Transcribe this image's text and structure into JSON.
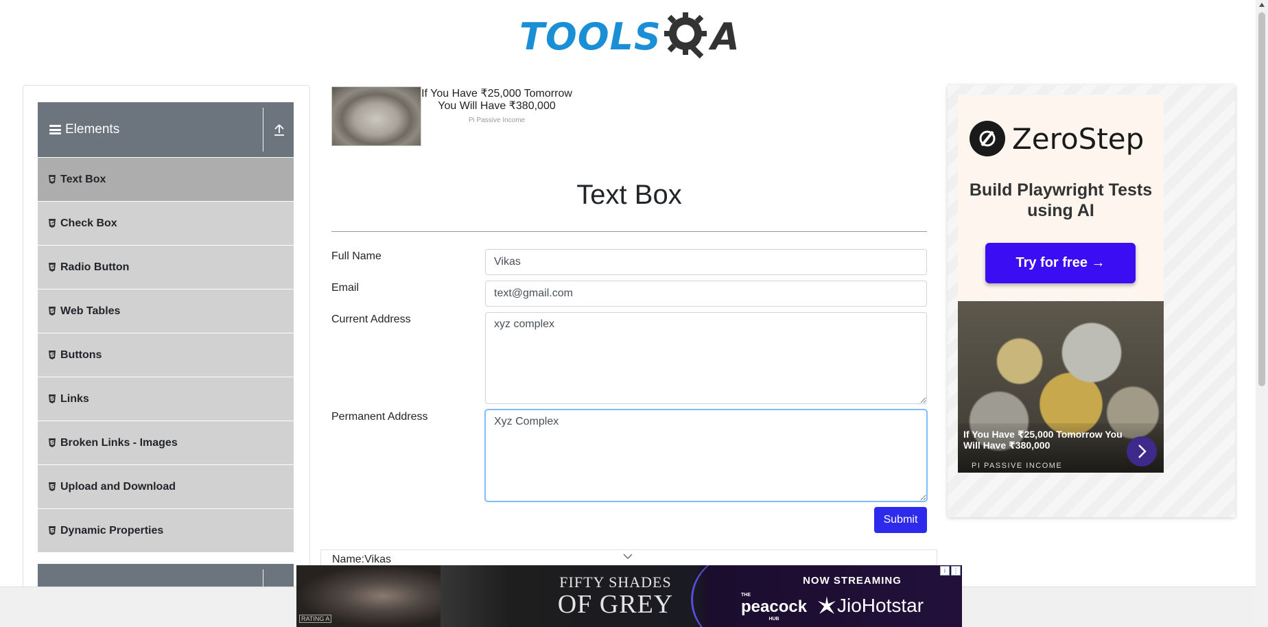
{
  "header": {
    "logo_tools": "TOOLS",
    "logo_a": "A"
  },
  "sidebar": {
    "group_title": "Elements",
    "items": [
      {
        "label": "Text Box",
        "active": true
      },
      {
        "label": "Check Box"
      },
      {
        "label": "Radio Button"
      },
      {
        "label": "Web Tables"
      },
      {
        "label": "Buttons"
      },
      {
        "label": "Links"
      },
      {
        "label": "Broken Links - Images"
      },
      {
        "label": "Upload and Download"
      },
      {
        "label": "Dynamic Properties"
      }
    ]
  },
  "ad_top": {
    "headline": "If You Have ₹25,000 Tomorrow You Will Have ₹380,000",
    "source": "Pi Passive Income"
  },
  "main": {
    "title": "Text Box",
    "form": {
      "full_name_label": "Full Name",
      "full_name_value": "Vikas",
      "email_label": "Email",
      "email_value": "text@gmail.com",
      "current_address_label": "Current Address",
      "current_address_value": "xyz complex",
      "permanent_address_label": "Permanent Address",
      "permanent_address_value": "Xyz Complex",
      "submit_label": "Submit"
    },
    "output": {
      "name_line": "Name:Vikas"
    }
  },
  "ad_right": {
    "brand": "ZeroStep",
    "tagline": "Build Playwright Tests using AI",
    "cta": "Try for free →",
    "coins_headline": "If You Have ₹25,000 Tomorrow You Will Have ₹380,000",
    "coins_source": "PI PASSIVE INCOME"
  },
  "banner_ad": {
    "title_line1": "FIFTY SHADES",
    "title_line2": "OF GREY",
    "now_streaming": "NOW STREAMING",
    "peacock_the": "THE",
    "peacock": "peacock",
    "peacock_hub": "HUB",
    "jio": "JioHotstar",
    "rating": "RATING A"
  },
  "colors": {
    "primary_button": "#2d2aeb",
    "sidebar_header": "#6c757d",
    "sidebar_item": "#d1d1d1",
    "sidebar_item_active": "#adadad",
    "logo_blue": "#1a8fd6",
    "zerostep_cta": "#3a0df2"
  }
}
